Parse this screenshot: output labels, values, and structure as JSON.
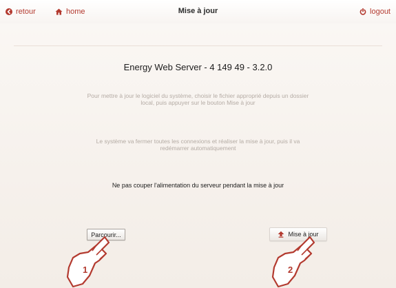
{
  "header": {
    "back_label": "retour",
    "home_label": "home",
    "title": "Mise à jour",
    "logout_label": "logout",
    "back_icon": "back-arrow-icon",
    "home_icon": "home-icon",
    "logout_icon": "power-icon"
  },
  "content": {
    "product_title": "Energy Web Server - 4 149 49 - 3.2.0",
    "info_1": "Pour mettre à jour le logiciel du système, choisir le fichier approprié depuis un dossier local, puis appuyer sur le bouton Mise à jour",
    "info_2": "Le système va fermer toutes les connexions et réaliser la mise à jour, puis il va redémarrer automatiquement",
    "warning": "Ne pas couper l'alimentation du serveur pendant la mise à jour"
  },
  "buttons": {
    "browse_label": "Parcourir...",
    "update_label": "Mise à jour",
    "update_icon": "upload-arrow-icon"
  },
  "callouts": {
    "first": "1",
    "second": "2"
  },
  "colors": {
    "accent": "#b33a2f",
    "background": "#f6f1ec",
    "muted_text": "#b4aba4"
  }
}
